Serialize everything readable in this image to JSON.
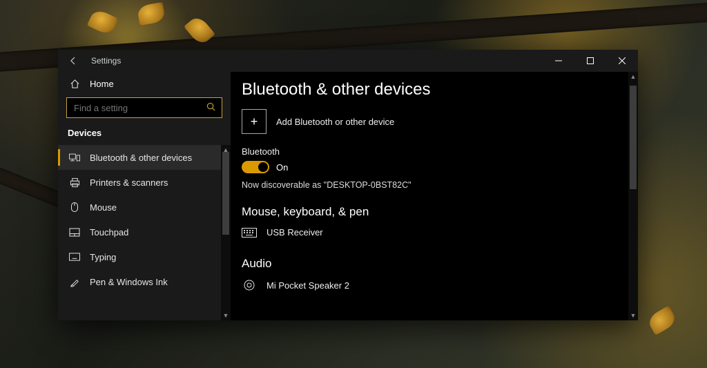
{
  "titlebar": {
    "title": "Settings"
  },
  "sidebar": {
    "home_label": "Home",
    "search_placeholder": "Find a setting",
    "section_label": "Devices",
    "items": [
      {
        "label": "Bluetooth & other devices"
      },
      {
        "label": "Printers & scanners"
      },
      {
        "label": "Mouse"
      },
      {
        "label": "Touchpad"
      },
      {
        "label": "Typing"
      },
      {
        "label": "Pen & Windows Ink"
      }
    ]
  },
  "content": {
    "page_title": "Bluetooth & other devices",
    "add_device_label": "Add Bluetooth or other device",
    "bluetooth_label": "Bluetooth",
    "toggle_state": "On",
    "discoverable_text": "Now discoverable as \"DESKTOP-0BST82C\"",
    "section_mouse_title": "Mouse, keyboard, & pen",
    "device_usb_label": "USB Receiver",
    "section_audio_title": "Audio",
    "device_speaker_label": "Mi Pocket Speaker 2"
  }
}
